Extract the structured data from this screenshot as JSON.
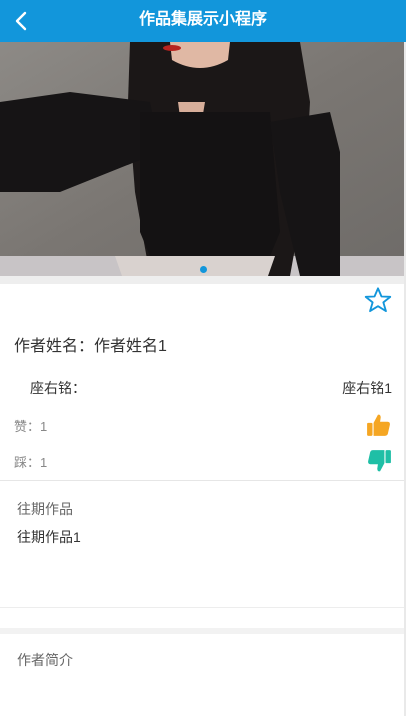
{
  "nav": {
    "title": "作品集展示小程序",
    "back_icon": "chevron-left-icon",
    "background": "#1296db"
  },
  "hero": {
    "image_alt": "作品图片",
    "indicator_count": 1,
    "active_index": 0,
    "indicator_color": "#1296db"
  },
  "info": {
    "favorite_icon": "star-outline-icon",
    "author_line": "作者姓名：作者姓名1",
    "motto_label": "座右铭：",
    "motto_value": "座右铭1",
    "like_text": "赞：1",
    "like_icon": "thumbs-up-icon",
    "like_color": "#f5a623",
    "dislike_text": "踩：1",
    "dislike_icon": "thumbs-down-icon",
    "dislike_color": "#1fbfa6"
  },
  "past_works": {
    "title": "往期作品",
    "items": [
      "往期作品1"
    ]
  },
  "intro": {
    "title": "作者简介"
  }
}
